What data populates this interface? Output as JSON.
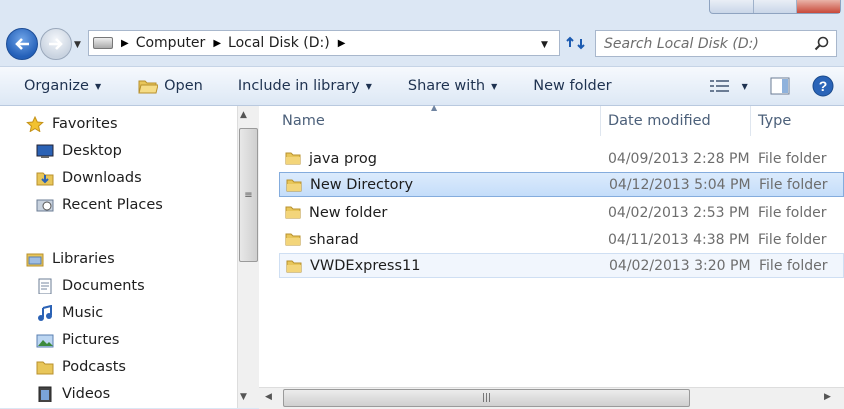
{
  "address": {
    "crumbs": [
      "Computer",
      "Local Disk (D:)"
    ]
  },
  "search": {
    "placeholder": "Search Local Disk (D:)"
  },
  "toolbar": {
    "organize": "Organize",
    "open": "Open",
    "include_in_library": "Include in library",
    "share_with": "Share with",
    "new_folder": "New folder"
  },
  "nav": {
    "favorites": {
      "label": "Favorites",
      "items": [
        "Desktop",
        "Downloads",
        "Recent Places"
      ]
    },
    "libraries": {
      "label": "Libraries",
      "items": [
        "Documents",
        "Music",
        "Pictures",
        "Podcasts",
        "Videos"
      ]
    }
  },
  "columns": {
    "name": "Name",
    "date": "Date modified",
    "type": "Type"
  },
  "files": [
    {
      "name": "java prog",
      "date": "04/09/2013 2:28 PM",
      "type": "File folder",
      "state": "normal"
    },
    {
      "name": "New Directory",
      "date": "04/12/2013 5:04 PM",
      "type": "File folder",
      "state": "selected"
    },
    {
      "name": "New folder",
      "date": "04/02/2013 2:53 PM",
      "type": "File folder",
      "state": "normal"
    },
    {
      "name": "sharad",
      "date": "04/11/2013 4:38 PM",
      "type": "File folder",
      "state": "normal"
    },
    {
      "name": "VWDExpress11",
      "date": "04/02/2013 3:20 PM",
      "type": "File folder",
      "state": "hover"
    }
  ],
  "colors": {
    "selection": "#c4ddfa",
    "selection_border": "#84acdd",
    "toolbar_text": "#1e3250",
    "muted_text": "#6d6d6d"
  }
}
